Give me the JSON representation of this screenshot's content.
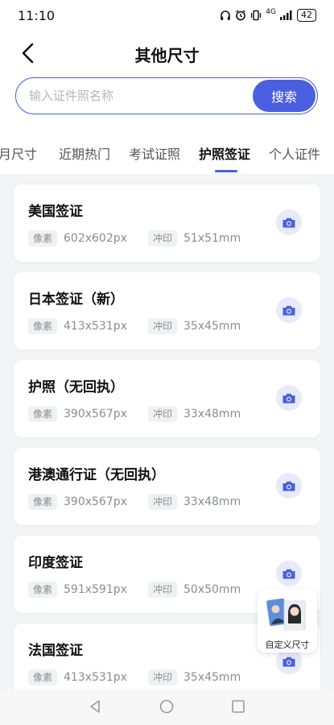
{
  "status_bar": {
    "time": "11:10",
    "network": "4G",
    "battery": "42"
  },
  "header": {
    "title": "其他尺寸"
  },
  "search": {
    "placeholder": "输入证件照名称",
    "button_label": "搜索"
  },
  "tabs": [
    {
      "label": "月尺寸",
      "active": false
    },
    {
      "label": "近期热门",
      "active": false
    },
    {
      "label": "考试证照",
      "active": false
    },
    {
      "label": "护照签证",
      "active": true
    },
    {
      "label": "个人证件",
      "active": false
    }
  ],
  "meta_labels": {
    "pixels": "像素",
    "print": "冲印"
  },
  "items": [
    {
      "name": "美国签证",
      "pixels": "602x602px",
      "print": "51x51mm"
    },
    {
      "name": "日本签证（新）",
      "pixels": "413x531px",
      "print": "35x45mm"
    },
    {
      "name": "护照（无回执）",
      "pixels": "390x567px",
      "print": "33x48mm"
    },
    {
      "name": "港澳通行证（无回执）",
      "pixels": "390x567px",
      "print": "33x48mm"
    },
    {
      "name": "印度签证",
      "pixels": "591x591px",
      "print": "50x50mm"
    },
    {
      "name": "法国签证",
      "pixels": "413x531px",
      "print": "35x45mm"
    }
  ],
  "custom_size": {
    "label": "自定义尺寸"
  },
  "colors": {
    "accent": "#4a5fe0",
    "icon_bg": "#e6eafb",
    "page_bg": "#f3f4f6"
  },
  "icons": [
    "back-arrow-icon",
    "camera-icon",
    "headphones-icon",
    "alarm-icon",
    "vibrate-icon",
    "signal-icon",
    "battery-icon"
  ]
}
